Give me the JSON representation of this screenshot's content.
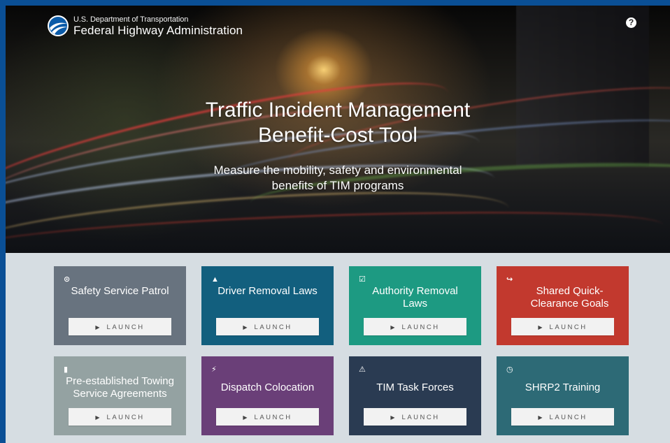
{
  "header": {
    "agency_sub": "U.S. Department of Transportation",
    "agency_main": "Federal Highway Administration",
    "help_icon": "question-circle-icon"
  },
  "hero": {
    "title_line1": "Traffic Incident Management",
    "title_line2": "Benefit-Cost Tool",
    "subtitle_line1": "Measure the mobility, safety and environmental",
    "subtitle_line2": "benefits of TIM programs"
  },
  "cards": [
    {
      "title": "Safety Service Patrol",
      "icon": "target-icon",
      "launch": "LAUNCH",
      "color": "#68737f"
    },
    {
      "title": "Driver Removal Laws",
      "icon": "road-icon",
      "launch": "LAUNCH",
      "color": "#125f7e"
    },
    {
      "title": "Authority Removal Laws",
      "icon": "edit-check-icon",
      "launch": "LAUNCH",
      "color": "#1d9a82"
    },
    {
      "title": "Shared Quick-Clearance Goals",
      "icon": "share-icon",
      "launch": "LAUNCH",
      "color": "#c2392e"
    },
    {
      "title": "Pre-established Towing Service Agreements",
      "icon": "file-icon",
      "launch": "LAUNCH",
      "color": "#94a2a2"
    },
    {
      "title": "Dispatch Colocation",
      "icon": "lightning-icon",
      "launch": "LAUNCH",
      "color": "#6a3f78"
    },
    {
      "title": "TIM Task Forces",
      "icon": "warning-icon",
      "launch": "LAUNCH",
      "color": "#2a3b52"
    },
    {
      "title": "SHRP2 Training",
      "icon": "clock-icon",
      "launch": "LAUNCH",
      "color": "#2d6a76"
    }
  ]
}
